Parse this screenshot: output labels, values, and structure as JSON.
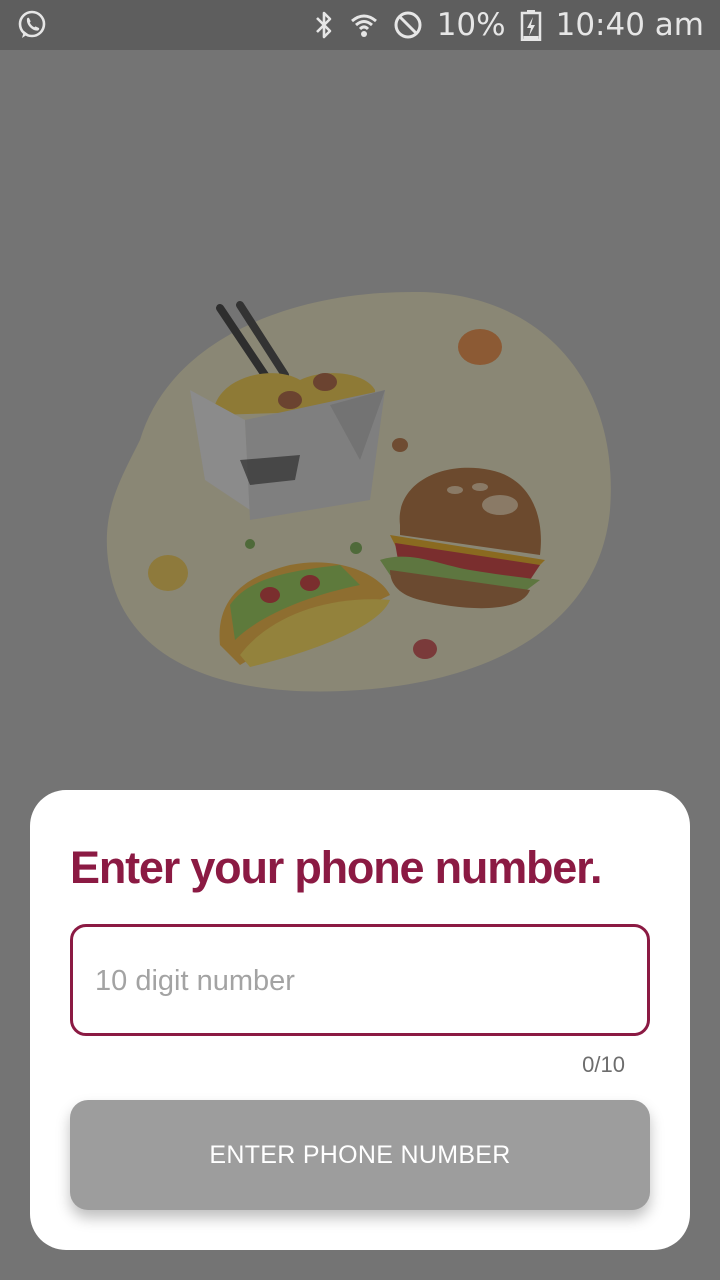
{
  "status_bar": {
    "left_icon": "whatsapp-icon",
    "icons": [
      "bluetooth-icon",
      "wifi-icon",
      "do-not-disturb-icon",
      "battery-charging-icon"
    ],
    "battery": "10%",
    "time": "10:40 am"
  },
  "illustration": {
    "icon": "food-illustration",
    "items": [
      "noodle-box",
      "burger",
      "taco"
    ]
  },
  "sheet": {
    "title": "Enter your phone number.",
    "phone_input": {
      "value": "",
      "placeholder": "10 digit number"
    },
    "counter": "0/10",
    "submit_label": "ENTER PHONE NUMBER"
  },
  "colors": {
    "accent": "#8b1a43",
    "button_disabled": "#9d9d9d",
    "overlay": "#747474"
  }
}
